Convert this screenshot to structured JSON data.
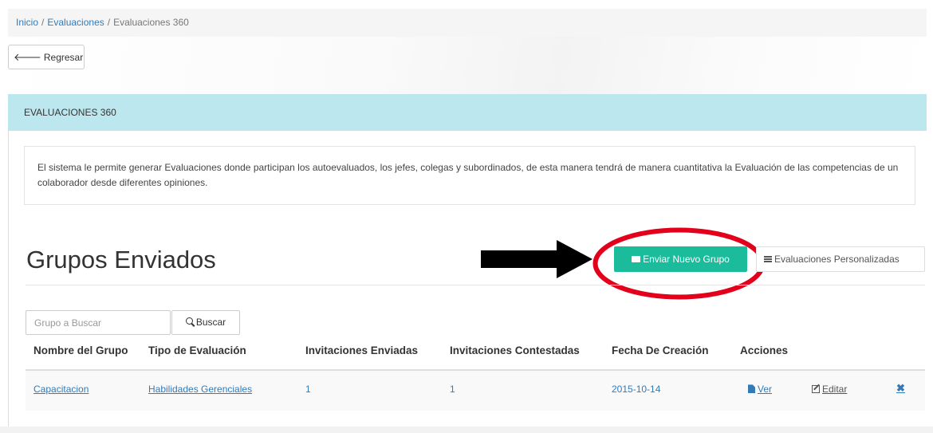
{
  "breadcrumb": {
    "items": [
      "Inicio",
      "Evaluaciones"
    ],
    "separator": "/",
    "current": "Evaluaciones 360"
  },
  "back_button": {
    "arrow_icon": "arrow-left-icon",
    "label": "Regresar"
  },
  "panel": {
    "heading": "EVALUACIONES 360"
  },
  "info_text": "El sistema le permite generar Evaluaciones donde participan los autoevaluados, los jefes, colegas y subordinados, de esta manera tendrá de manera cuantitativa la Evaluación de las competencias de un colaborador desde diferentes opiniones.",
  "section": {
    "title": "Grupos Enviados",
    "primary_button": {
      "icon": "envelope-icon",
      "label": "Enviar Nuevo Grupo"
    },
    "secondary_button": {
      "icon": "list-icon",
      "label": "Evaluaciones Personalizadas"
    }
  },
  "search": {
    "placeholder": "Grupo a Buscar",
    "value": "",
    "button_label": "Buscar",
    "button_icon": "search-icon"
  },
  "table": {
    "headers": [
      "Nombre del Grupo",
      "Tipo de Evaluación",
      "Invitaciones Enviadas",
      "Invitaciones Contestadas",
      "Fecha De Creación",
      "Acciones"
    ],
    "rows": [
      {
        "nombre": "Capacitacion",
        "tipo": "Habilidades Gerenciales",
        "enviadas": "1",
        "contestadas": "1",
        "fecha": "2015-10-14",
        "ver_label": "Ver",
        "editar_label": "Editar",
        "delete_glyph": "✖"
      }
    ]
  },
  "annotations": {
    "arrow_color": "#000000",
    "ellipse_color": "#e3001b"
  },
  "colors": {
    "accent": "#1abc9c",
    "link": "#337ab7",
    "panel_heading": "#bde7ee"
  }
}
